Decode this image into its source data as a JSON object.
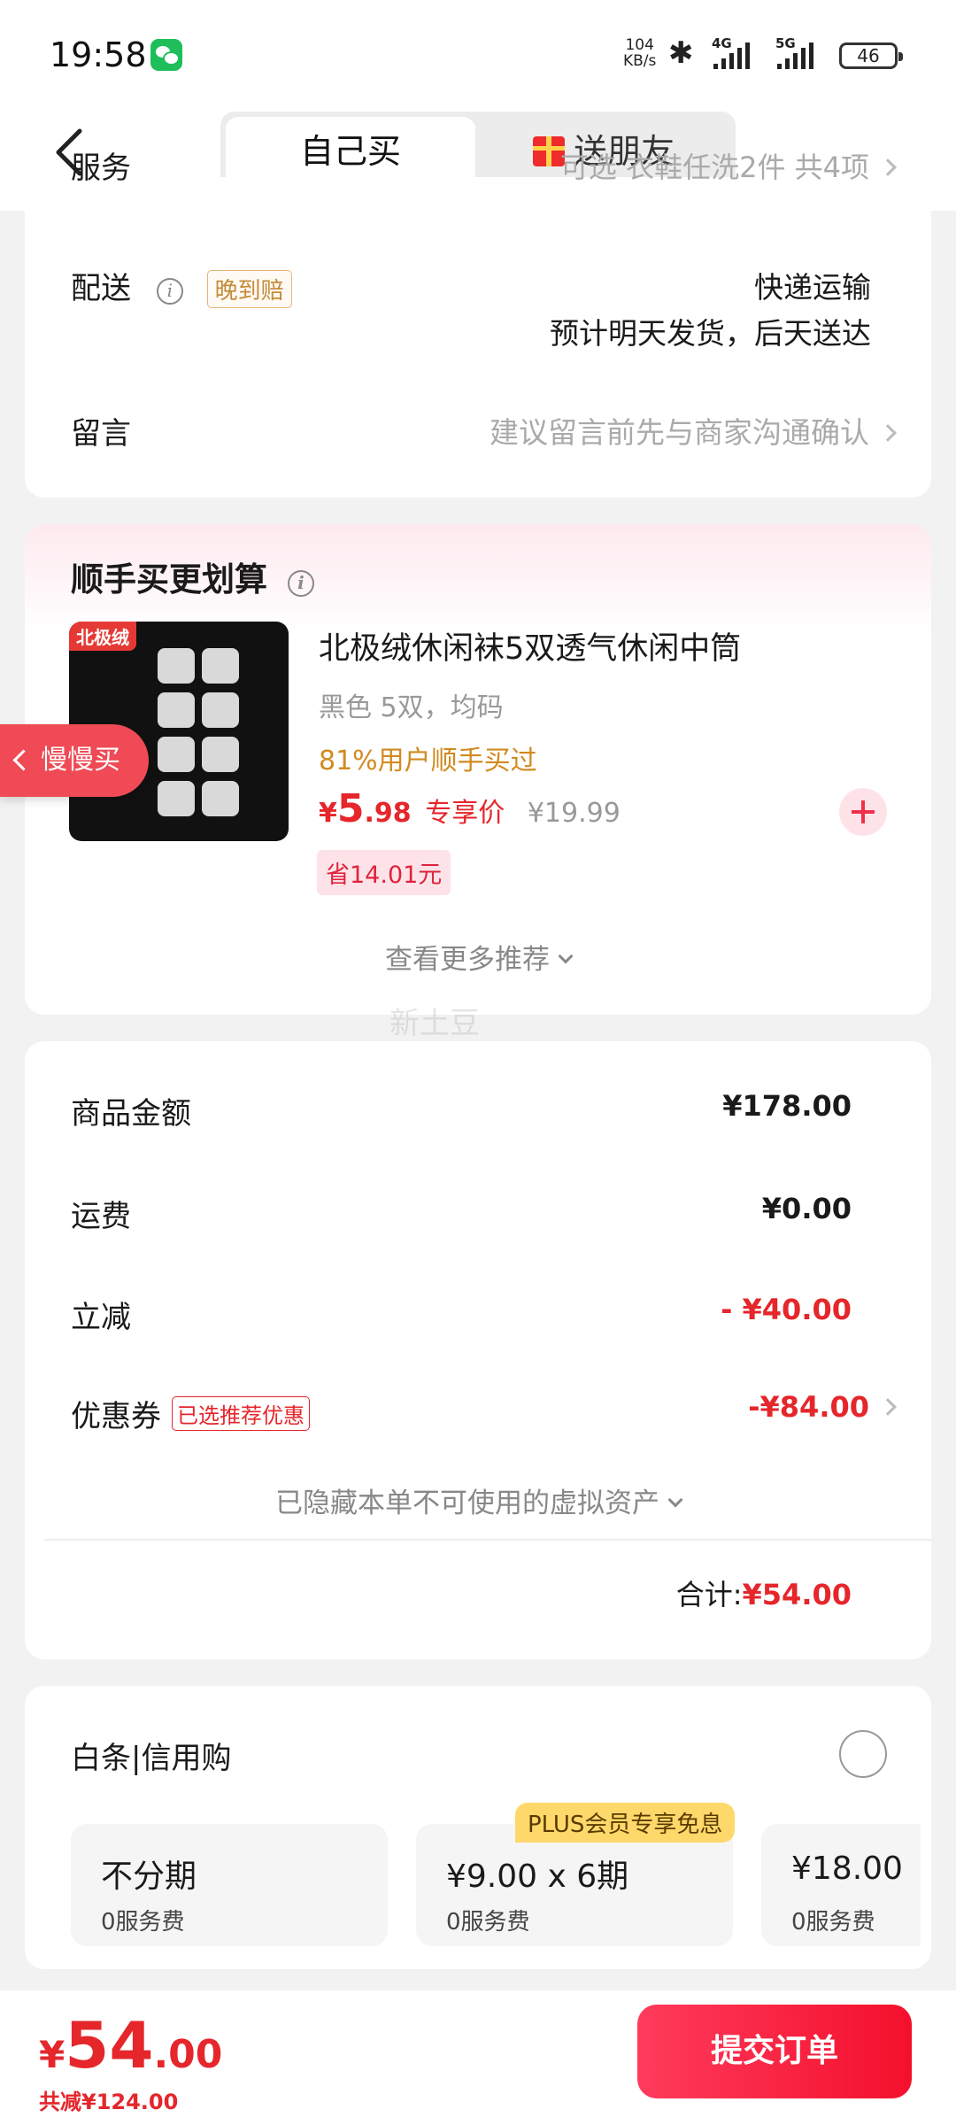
{
  "status_bar": {
    "time": "19:58",
    "net_speed_value": "104",
    "net_speed_unit": "KB/s",
    "signal1_label": "4G",
    "signal2_label": "5G",
    "battery": "46"
  },
  "header": {
    "tab_self": "自己买",
    "tab_gift": "送朋友"
  },
  "shipping": {
    "service_label": "服务",
    "service_value": "可选 衣鞋任洗2件 共4项",
    "delivery_label": "配送",
    "late_badge": "晚到赔",
    "delivery_method": "快递运输",
    "delivery_eta": "预计明天发货，后天送达",
    "note_label": "留言",
    "note_placeholder": "建议留言前先与商家沟通确认"
  },
  "addon": {
    "title": "顺手买更划算",
    "brand_logo_text": "北极绒",
    "product_name": "北极绒休闲袜5双透气休闲中筒",
    "product_spec": "黑色 5双，均码",
    "social_proof": "81%用户顺手买过",
    "price_currency": "¥",
    "price_int": "5",
    "price_dec": ".98",
    "price_tag": "专享价",
    "original_price": "¥19.99",
    "save_amount": "省14.01元",
    "more_label": "查看更多推荐"
  },
  "slow_buy_label": "慢慢买",
  "watermark": "新土豆",
  "summary": {
    "goods_label": "商品金额",
    "goods_value": "¥178.00",
    "freight_label": "运费",
    "freight_value": "¥0.00",
    "discount_label": "立减",
    "discount_value": "- ¥40.00",
    "coupon_label": "优惠券",
    "coupon_badge": "已选推荐优惠",
    "coupon_value": "-¥84.00",
    "hidden_assets": "已隐藏本单不可使用的虚拟资产",
    "total_label": "合计:",
    "total_value": "¥54.00"
  },
  "credit": {
    "title": "白条|信用购",
    "plus_badge": "PLUS会员专享免息",
    "plans": [
      {
        "amount": "不分期",
        "fee": "0服务费"
      },
      {
        "amount": "¥9.00 x 6期",
        "fee": "0服务费"
      },
      {
        "amount": "¥18.00",
        "fee": "0服务费"
      }
    ]
  },
  "footer": {
    "currency": "¥",
    "total_int": "54",
    "total_dec": ".00",
    "total_saved": "共减¥124.00",
    "submit_label": "提交订单"
  },
  "colors": {
    "accent_red": "#e5262b",
    "submit_gradient_start": "#ff3b5c",
    "submit_gradient_end": "#f3102c"
  }
}
